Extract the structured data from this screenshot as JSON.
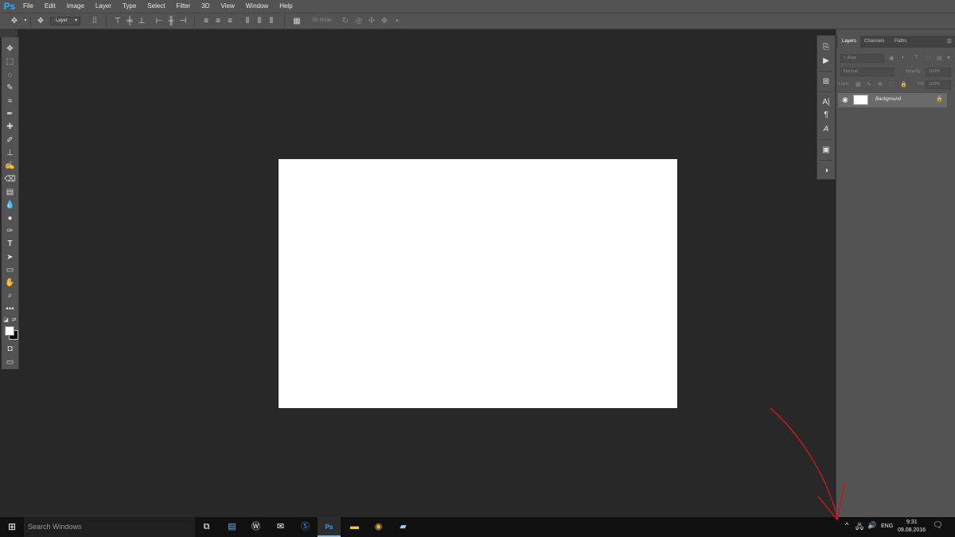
{
  "app": {
    "logo": "Ps"
  },
  "menu": [
    "File",
    "Edit",
    "Image",
    "Layer",
    "Type",
    "Select",
    "Filter",
    "3D",
    "View",
    "Window",
    "Help"
  ],
  "options_bar": {
    "auto_select_target": "Layer",
    "mode_3d_label": "3D Mode:"
  },
  "layers_panel": {
    "tabs": [
      "Layers",
      "Channels",
      "Paths"
    ],
    "filter_placeholder": "Kind",
    "blend_mode": "Normal",
    "opacity_label": "Opacity:",
    "opacity_value": "100%",
    "lock_label": "Lock:",
    "fill_label": "Fill:",
    "fill_value": "100%",
    "layers": [
      {
        "name": "Background",
        "visible": true,
        "locked": true
      }
    ]
  },
  "taskbar": {
    "search_placeholder": "Search Windows",
    "language": "ENG",
    "time": "9:31",
    "date": "09.08.2016"
  },
  "colors": {
    "workspace": "#282828",
    "panel": "#535353",
    "canvas": "#ffffff",
    "annotation_arrow": "#c0181e",
    "ps_blue": "#31a8ff",
    "foreground_swatch": "#ffffff",
    "background_swatch": "#000000"
  }
}
